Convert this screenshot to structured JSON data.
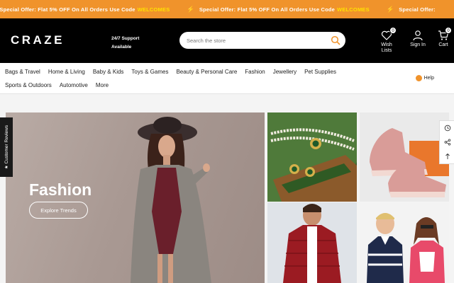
{
  "announcement": {
    "items": [
      {
        "text": "Special Offer: Flat 5% OFF On All Orders Use Code",
        "code": "WELCOMES"
      },
      {
        "text": "Special Offer: Flat 5% OFF On All Orders Use Code",
        "code": "WELCOMES"
      },
      {
        "text": "Special Offer:",
        "code": ""
      }
    ],
    "bolt": "⚡"
  },
  "header": {
    "logo": "CRAZE",
    "support_line1": "24/7 Support",
    "support_line2": "Available",
    "search_placeholder": "Search the store",
    "wishlist_label_1": "Wish",
    "wishlist_label_2": "Lists",
    "wishlist_count": "0",
    "signin_label": "Sign In",
    "cart_label": "Cart",
    "cart_count": "0"
  },
  "nav": {
    "row1": [
      "Bags & Travel",
      "Home & Living",
      "Baby & Kids",
      "Toys & Games",
      "Beauty & Personal Care",
      "Fashion",
      "Jewellery",
      "Pet Supplies"
    ],
    "row2": [
      "Sports & Outdoors",
      "Automotive",
      "More"
    ],
    "help": "Help"
  },
  "hero": {
    "title": "Fashion",
    "button": "Explore Trends"
  },
  "side": {
    "reviews_tab": "★ Customer Reviews"
  },
  "colors": {
    "announcement_bg": "#f0932b",
    "header_bg": "#000000",
    "accent": "#f0932b",
    "code_color": "#ffe100"
  }
}
